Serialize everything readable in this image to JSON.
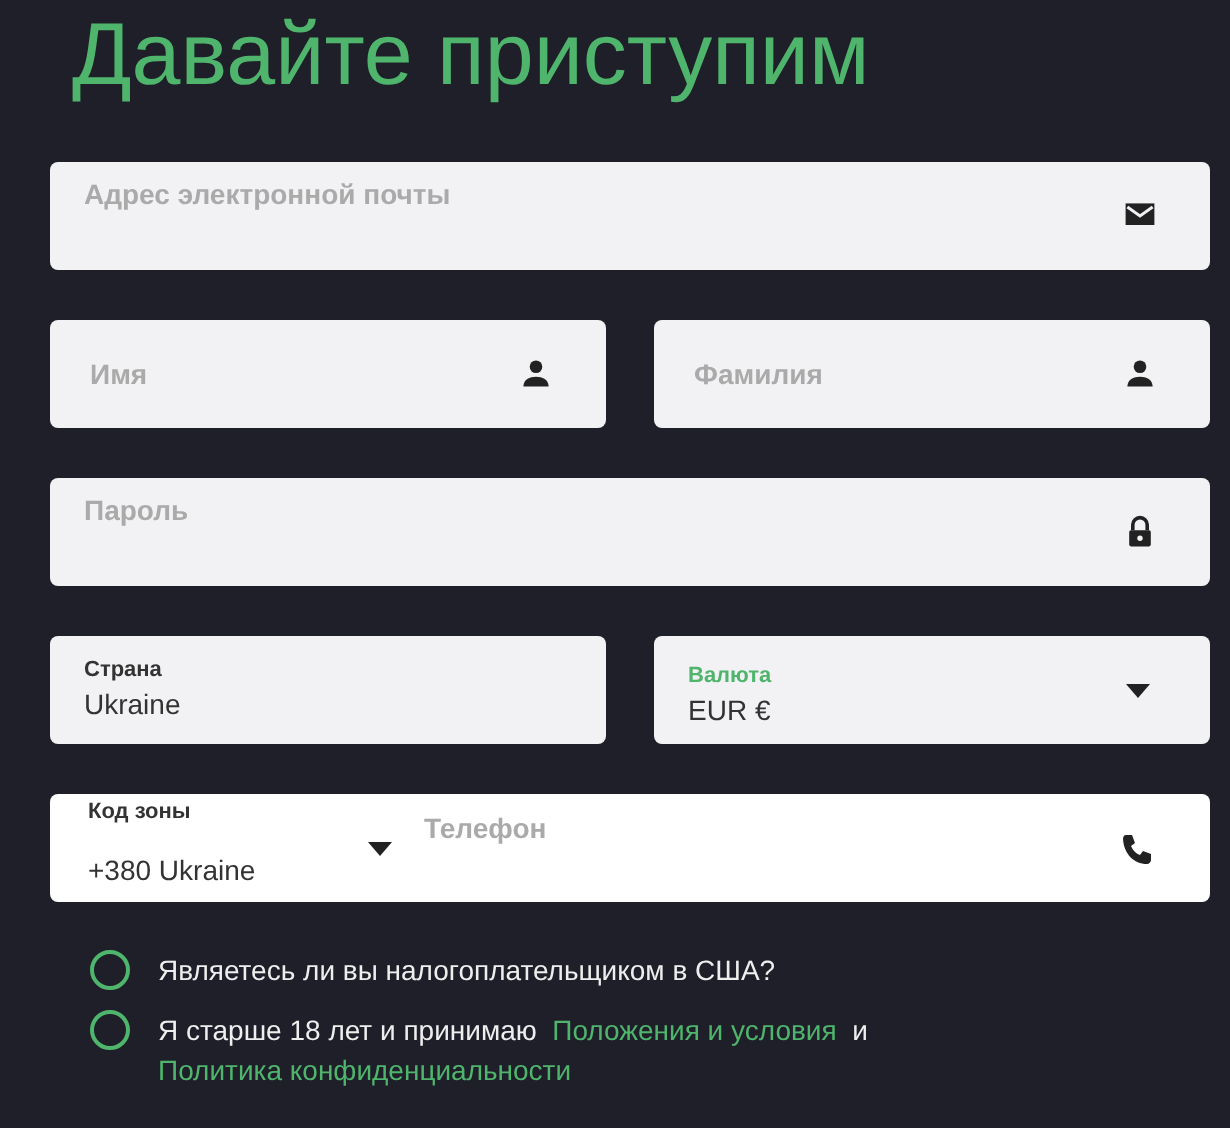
{
  "title": "Давайте приступим",
  "fields": [
    [
      {
        "kind": "email",
        "placeholder": "Адрес электронной почты"
      }
    ],
    [
      {
        "kind": "name",
        "placeholder": "Имя"
      },
      {
        "kind": "name",
        "placeholder": "Фамилия"
      }
    ],
    [
      {
        "kind": "password",
        "placeholder": "Пароль"
      }
    ],
    [
      {
        "kind": "filled",
        "label": "Страна",
        "value": "Ukraine",
        "focused": false
      },
      {
        "kind": "select",
        "label": "Валюта",
        "value": "EUR €",
        "focused": true
      }
    ],
    [
      {
        "kind": "phone",
        "code_label": "Код зоны",
        "code_value": "+380 Ukraine",
        "placeholder": "Телефон"
      }
    ]
  ],
  "checkboxes": [
    {
      "checked": false,
      "parts": [
        {
          "kind": "text",
          "text": "Являетесь ли вы налогоплательщиком в США?"
        }
      ]
    },
    {
      "checked": false,
      "parts": [
        {
          "kind": "text",
          "text": "Я старше 18 лет и принимаю"
        },
        {
          "kind": "link",
          "text": "Положения и условия"
        },
        {
          "kind": "text",
          "text": "и"
        },
        {
          "kind": "link",
          "text": "Политика конфиденциальности"
        }
      ]
    }
  ]
}
